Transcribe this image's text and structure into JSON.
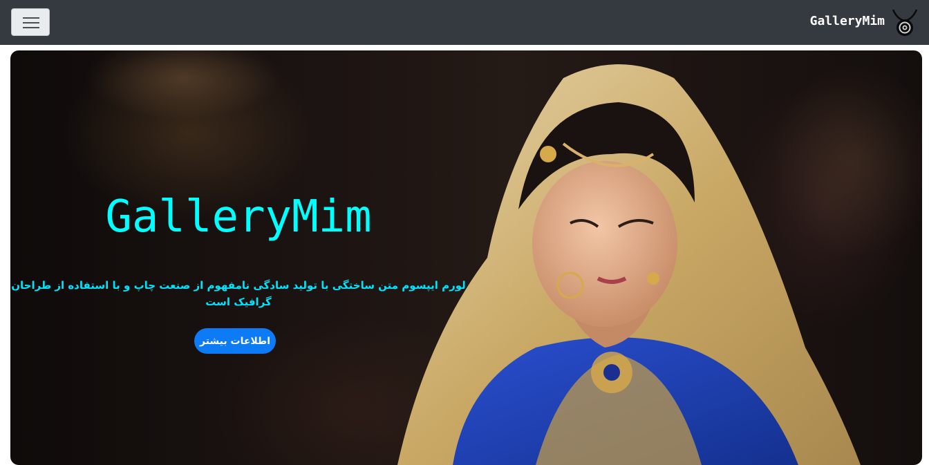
{
  "navbar": {
    "brand": "GalleryMim",
    "toggler_icon": "hamburger-menu-icon",
    "logo_icon": "pendant-logo-icon"
  },
  "hero": {
    "title": "GalleryMim",
    "text": "لورم ایپسوم متن ساختگی با تولید سادگی نامفهوم از صنعت چاپ و با استفاده از طراحان گرافیک است",
    "button_label": "اطلاعات بیشتر"
  },
  "colors": {
    "navbar_bg": "#343a40",
    "hero_text": "#00ffff",
    "button_bg": "#0d7bf5",
    "button_text": "#ffffff"
  }
}
